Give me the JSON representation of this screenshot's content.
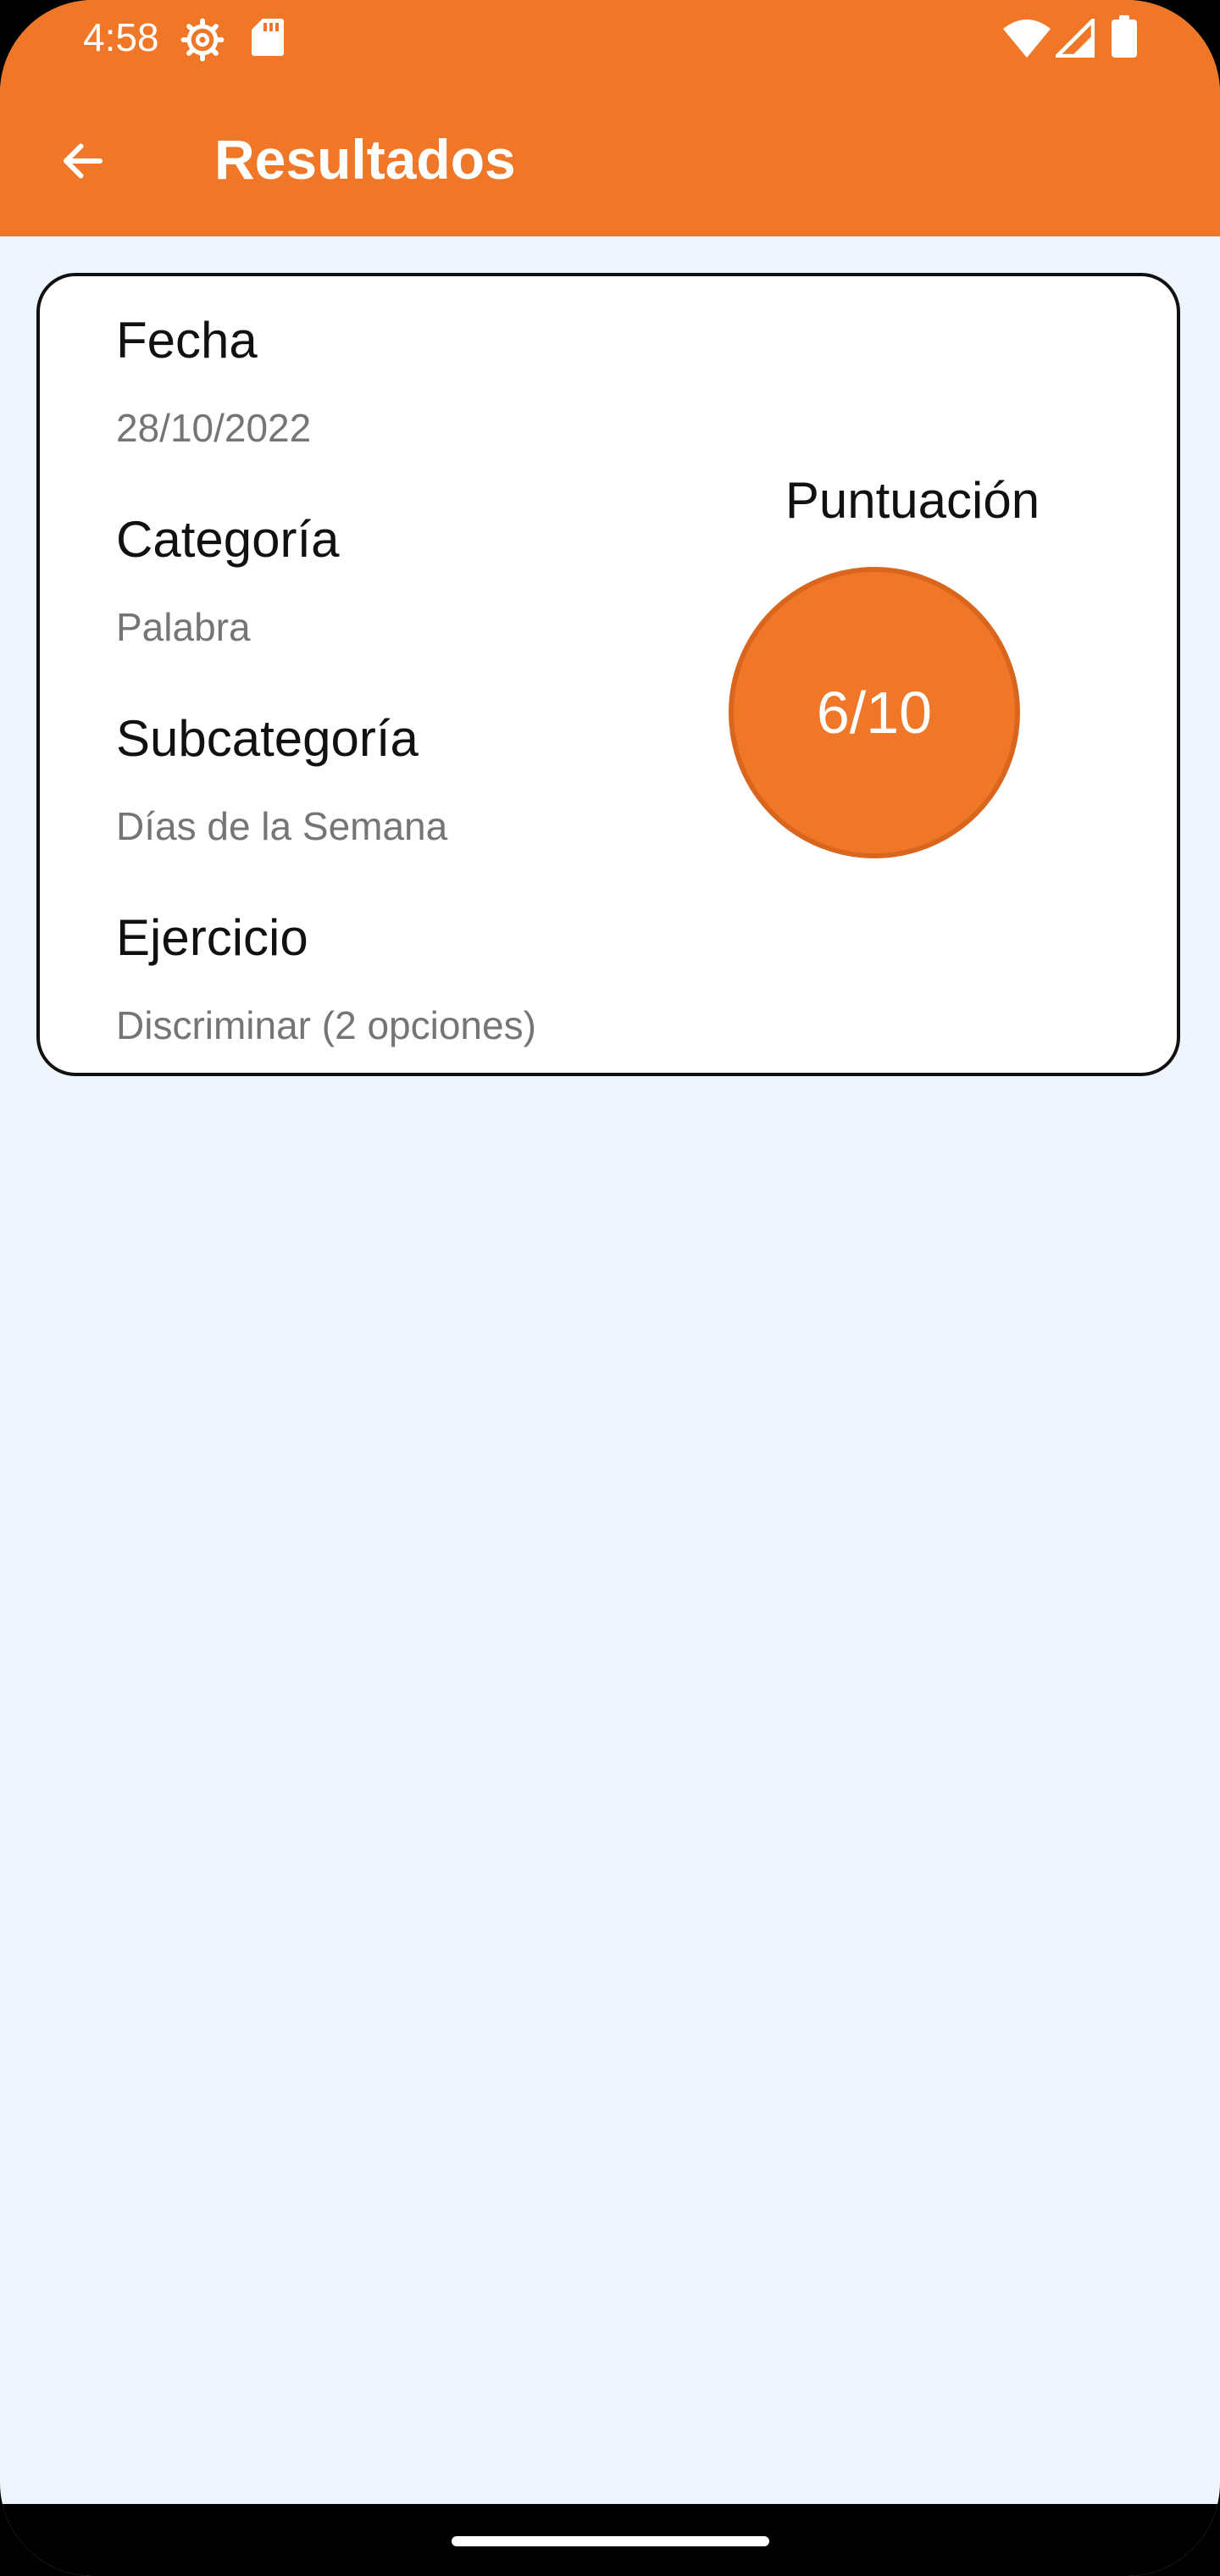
{
  "status_bar": {
    "time": "4:58",
    "icons": [
      "settings-icon",
      "sd-card-icon",
      "wifi-icon",
      "cell-signal-icon",
      "battery-icon"
    ]
  },
  "toolbar": {
    "back_icon": "arrow-back-icon",
    "title": "Resultados"
  },
  "result": {
    "fields": [
      {
        "label": "Fecha",
        "value": "28/10/2022"
      },
      {
        "label": "Categoría",
        "value": "Palabra"
      },
      {
        "label": "Subcategoría",
        "value": "Días de la Semana"
      },
      {
        "label": "Ejercicio",
        "value": "Discriminar (2 opciones)"
      }
    ],
    "score_label": "Puntuación",
    "score": "6/10"
  },
  "colors": {
    "accent": "#EF7727",
    "background": "#EEF5FC",
    "card": "#FFFFFF",
    "label_text": "#111111",
    "value_text": "#757575"
  }
}
